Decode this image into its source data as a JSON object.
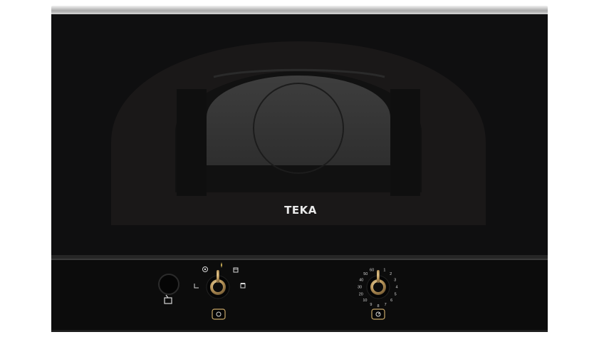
{
  "brand": "TEKA",
  "colors": {
    "body": "#0b0b0c",
    "door_arch": "#1b1919",
    "window_glass": "#383838",
    "trim": "#c9c9c9",
    "knob_brass": "#b8955a"
  },
  "knob_left": {
    "icons": [
      "power-icon",
      "defrost-icon",
      "grill-icon",
      "combi-icon",
      "microwave-icon"
    ],
    "button_icon": "power-button-icon"
  },
  "knob_right": {
    "dial_marks": [
      "1",
      "2",
      "3",
      "4",
      "5",
      "6",
      "7",
      "8",
      "9",
      "10",
      "20",
      "30",
      "40",
      "50",
      "60"
    ],
    "button_icon": "timer-button-icon"
  },
  "door_button_icon": "door-open-icon"
}
